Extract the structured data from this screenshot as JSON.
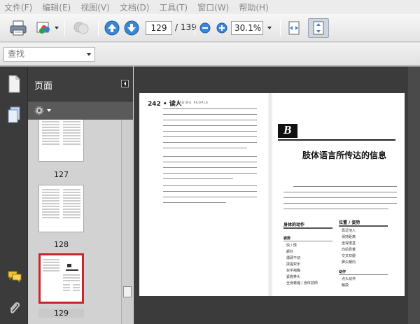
{
  "menubar": {
    "items": [
      "文件(F)",
      "编辑(E)",
      "视图(V)",
      "文档(D)",
      "工具(T)",
      "窗口(W)",
      "帮助(H)"
    ]
  },
  "toolbar": {
    "current_page": "129",
    "page_total": "/ 139",
    "zoom": "30.1%"
  },
  "search": {
    "placeholder": "查找"
  },
  "panel": {
    "title": "页面",
    "thumbnails": [
      {
        "label": "127"
      },
      {
        "label": "128"
      },
      {
        "label": "129",
        "selected": true
      }
    ]
  },
  "document": {
    "left_page_header": "242 • 读人",
    "left_page_header_sub": "READING PEOPLE",
    "chapter_letter": "B",
    "chapter_title": "肢体语言所传达的信息",
    "section_body_actions": "身体的动作",
    "section_posture": "姿势",
    "section_position": "位置 / 姿势",
    "section_actions": "动作",
    "posture_items": [
      "快 / 慢",
      "颤抖",
      "僵硬不动",
      "揉搓双手",
      "双手抱胸",
      "紧握拳头",
      "全身蜷缩 / 身体前倾"
    ],
    "position_items": [
      "靠近他人",
      "保持距离",
      "坐得很直",
      "向后靠着",
      "交叉双腿",
      "脚尖朝向"
    ],
    "action_items": [
      "点头动作",
      "触摸"
    ]
  },
  "colors": {
    "selection": "#c9252b",
    "panel_bg": "#3e3e3e",
    "doc_bg": "#3b3b3b"
  }
}
